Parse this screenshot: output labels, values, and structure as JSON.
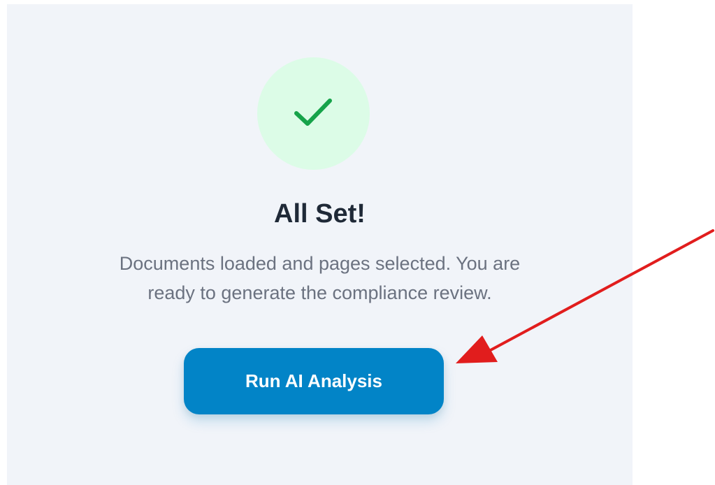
{
  "status": {
    "icon": "check-icon",
    "title": "All Set!",
    "description_line1": "Documents loaded and pages selected. You are",
    "description_line2": "ready to generate the compliance review."
  },
  "actions": {
    "run_label": "Run AI Analysis"
  },
  "colors": {
    "panel_bg": "#f1f4f9",
    "check_circle_bg": "#dcfce7",
    "check_stroke": "#16a34a",
    "button_bg": "#0284c7",
    "annotation_arrow": "#e11d1d"
  }
}
